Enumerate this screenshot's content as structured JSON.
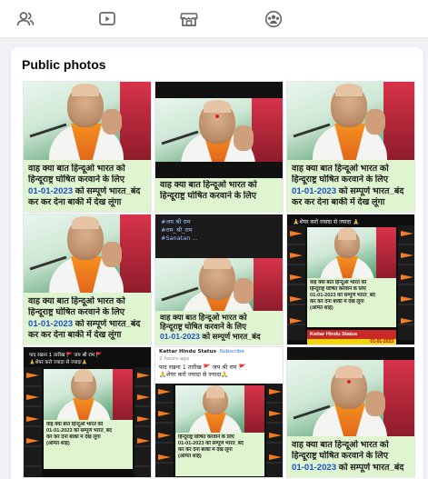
{
  "topnav": {
    "tabs": [
      {
        "name": "people-icon"
      },
      {
        "name": "video-icon"
      },
      {
        "name": "marketplace-icon"
      },
      {
        "name": "groups-icon"
      }
    ]
  },
  "section": {
    "title": "Public photos"
  },
  "poster": {
    "line1": "वाह क्या बात हिन्दूओ भारत को",
    "line2": "हिन्दूराष्ट्र घोषित करवाने के लिए",
    "date": "01-01-2023",
    "line3_rest": " को सम्पूर्ण भारत_बंद",
    "line4": "कर कर देना बाकी में देख लूंगा"
  },
  "dark_share": {
    "line1": "#जय श्री राम",
    "line2": "#राम_श्री_राम",
    "line3": "#Sanatan ..."
  },
  "collage": {
    "header": "🙏शेयर करो ज्यादा से ज्यादा 🙏",
    "status_label": "Kattar Hindu Status",
    "status_date": "01-01-2023",
    "sub_line1": "वाह क्या बात हिन्दूओ भारत को",
    "sub_line2": "हिन्दूराष्ट्र घोषित करवाने के लिए",
    "sub_line3": "01-01-2023 को सम्पूर्ण भारत_बंद",
    "sub_line4": "कर कर देना बाकी में देख लूंगा",
    "sub_line5": "(अमित शाह)"
  },
  "collage_small": {
    "header": "पाद रखना 1 तारीख 🚩 जय श्री राम 🚩",
    "header2": "🙏शेयर करो ज्यादा से ज्यादा🙏"
  },
  "fb_post": {
    "name": "Kattar Hindu Status",
    "subscribe": "· Subscribe",
    "time": "2 hours ago",
    "text1": "पाद रखना 1 तारीख 🚩 जय श्री राम 🚩",
    "text2": "🙏शेयर करो ज्यादा से ज्यादा🙏"
  }
}
